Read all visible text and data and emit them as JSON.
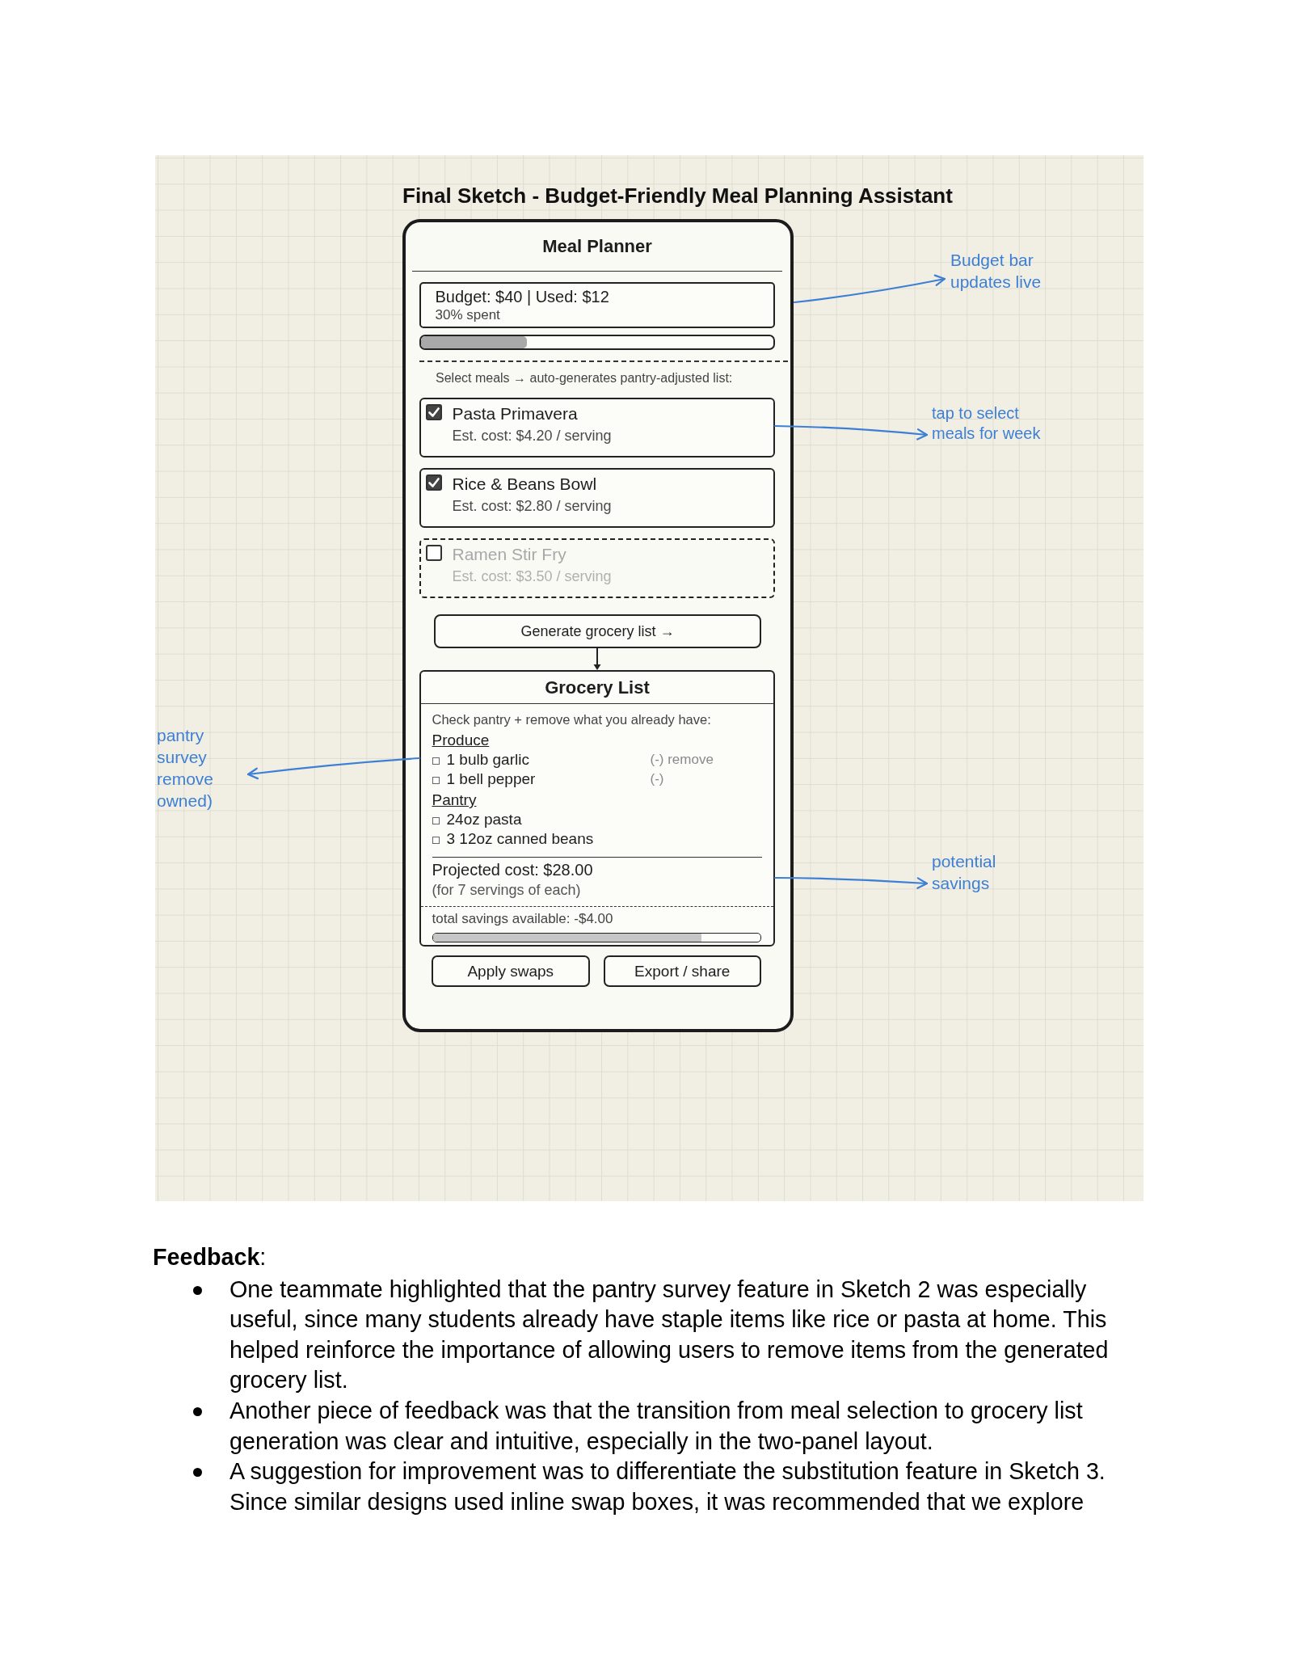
{
  "sketch": {
    "title": "Final Sketch - Budget-Friendly Meal Planning Assistant",
    "app": {
      "title": "Meal Planner",
      "budget": {
        "summary": "Budget: $40 | Used: $12",
        "percent": "30% spent",
        "level": 0.3
      },
      "instruction": "Select meals → auto-generates pantry-adjusted list:",
      "meals": [
        {
          "name": "Pasta Primavera",
          "cost": "Est. cost: $4.20 / serving",
          "selected": true
        },
        {
          "name": "Rice & Beans Bowl",
          "cost": "Est. cost: $2.80 / serving",
          "selected": true
        },
        {
          "name": "Ramen Stir Fry",
          "cost": "Est. cost: $3.50 / serving",
          "selected": false
        }
      ],
      "generate_button": "Generate grocery list →",
      "grocery": {
        "title": "Grocery List",
        "instruction": "Check pantry + remove what you already have:",
        "sections": [
          {
            "name": "Produce",
            "items": [
              {
                "label": "1 bulb garlic",
                "checked": false,
                "action": "(-) remove"
              },
              {
                "label": "1 bell pepper",
                "checked": false,
                "action": "(-)"
              }
            ]
          },
          {
            "name": "Pantry",
            "items": [
              {
                "label": "24oz pasta",
                "checked": false
              },
              {
                "label": "3 12oz canned beans",
                "checked": false
              }
            ]
          }
        ],
        "projected_cost": "Projected cost: $28.00",
        "servings_note": "(for 7 servings of each)",
        "savings": {
          "label": "total savings available: -$4.00",
          "level": 0.82
        }
      },
      "actions": [
        "Apply swaps",
        "Export / share"
      ]
    },
    "annotations": [
      {
        "lines": [
          "Budget bar",
          "updates live"
        ]
      },
      {
        "lines": [
          "tap to select",
          "meals for week"
        ]
      },
      {
        "lines": [
          "pantry",
          "survey",
          "remove",
          "owned)"
        ]
      },
      {
        "lines": [
          "potential",
          "savings"
        ]
      }
    ]
  },
  "feedback": {
    "heading": "**Feedback**:",
    "items": [
      "One teammate highlighted that the pantry survey feature in Sketch 2 was especially useful, since many students already have staple items like rice or pasta at home. This helped reinforce the importance of allowing users to remove items from the generated grocery list.",
      "Another piece of feedback was that the transition from meal selection to grocery list generation was clear and intuitive, especially in the two-panel layout.",
      "A suggestion for improvement was to differentiate the substitution feature in Sketch 3. Since similar designs used inline swap boxes, it was recommended that we explore"
    ]
  }
}
